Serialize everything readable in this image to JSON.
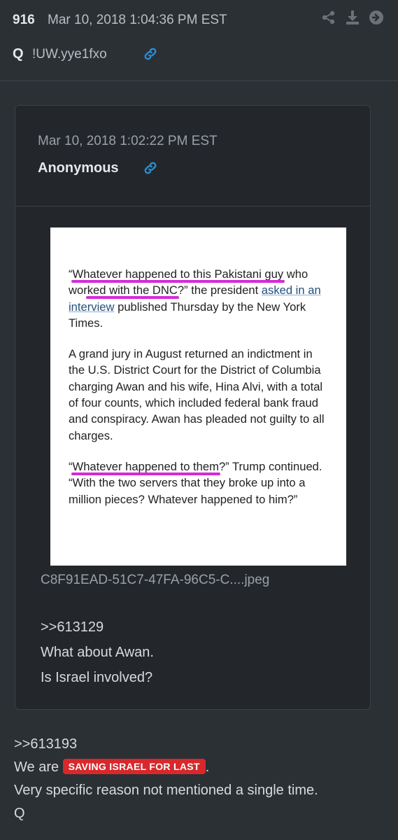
{
  "post": {
    "number": "916",
    "date": "Mar 10, 2018 1:04:36 PM EST",
    "author": "Q",
    "tripcode": "!UW.yye1fxo",
    "icons": [
      "share-icon",
      "download-icon",
      "arrow-right-circle-icon",
      "link-icon"
    ]
  },
  "quoted_post": {
    "date": "Mar 10, 2018 1:02:22 PM EST",
    "author": "Anonymous",
    "image": {
      "paragraph1": {
        "open_quote": "“",
        "hl1": "Whatever happened to this Pakistani guy",
        "after_hl1": " who",
        "before_hl2": "wor",
        "hl2": "ked with the DNC",
        "mid": "?” the president ",
        "link": "asked in an interview",
        "end": " published Thursday by the New York Times."
      },
      "paragraph2": "A grand jury in August returned an indictment in the U.S. District Court for the District of Columbia charging Awan and his wife, Hina Alvi, with a total of four counts, which included federal bank fraud and conspiracy. Awan has pleaded not guilty to all charges.",
      "paragraph3": {
        "open_quote": "“",
        "hl": "Whatever happened to them",
        "rest": "?” Trump continued. “With the two servers that they broke up into a million pieces? Whatever happened to him?”"
      }
    },
    "filename": "C8F91EAD-51C7-47FA-96C5-C....jpeg",
    "body": [
      ">>613129",
      "What about Awan.",
      "Is Israel involved?"
    ]
  },
  "body": {
    "line1": ">>613193",
    "line2_prefix": "We are ",
    "tag": "SAVING ISRAEL FOR LAST",
    "line2_suffix": ".",
    "line3": "Very specific reason not mentioned a single time.",
    "line4": "Q"
  },
  "colors": {
    "background": "#2b3035",
    "panel": "#23272c",
    "link_icon": "#2a8fd6",
    "highlight": "#d62ad6",
    "tag": "#d8282b"
  }
}
